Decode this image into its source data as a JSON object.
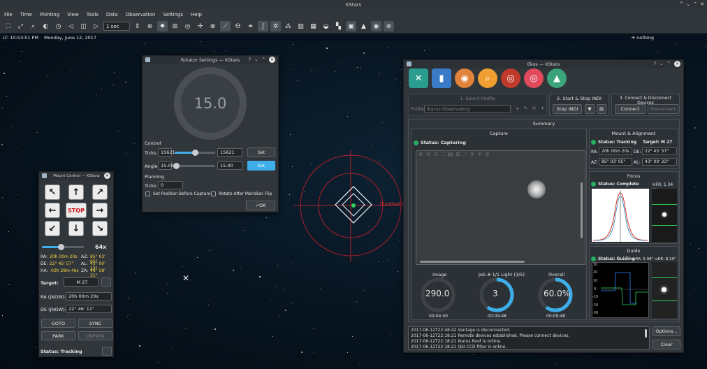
{
  "window": {
    "title": "KStars"
  },
  "menu": [
    "File",
    "Time",
    "Pointing",
    "View",
    "Tools",
    "Data",
    "Observation",
    "Settings",
    "Help"
  ],
  "toolbar": {
    "time_step": "1 sec"
  },
  "status": {
    "lt": "LT: 10:53:51 PM",
    "date": "Monday, June 12, 2017",
    "object": "nothing"
  },
  "sky": {
    "target_label": "Dumbbell Ne"
  },
  "rotator": {
    "title": "Rotator Settings — KStars",
    "dial_value": "15.0",
    "control_label": "Control",
    "ticks_label": "Ticks:",
    "ticks_value": "15621",
    "ticks_spin": "15621",
    "ticks_fraction": 0.5,
    "angle_label": "Angle:",
    "angle_value": "15.00",
    "angle_spin": "15.00",
    "angle_fraction": 0.04,
    "set_label": "Set",
    "planning_label": "Planning",
    "plan_ticks_label": "Ticks:",
    "plan_ticks_value": "0",
    "set_before_capture": "Set Position Before Capture",
    "rotate_after_flip": "Rotate After Meridian Flip",
    "ok_label": "OK"
  },
  "mount": {
    "title": "Mount Control — KStars",
    "stop_label": "STOP",
    "speed": "64x",
    "speed_fraction": 0.45,
    "ra_label": "RA:",
    "ra": "20h 00m 20s",
    "az_label": "AZ:",
    "az": "85° 03' 05\"",
    "de_label": "DE:",
    "de": "22° 45' 57\"",
    "al_label": "AL:",
    "al": "43° 00' 23\"",
    "ha_label": "HA:",
    "ha": "-03h 28m 46s",
    "za_label": "ZA:",
    "za": "46° 58' 31\"",
    "target_label": "Target:",
    "target": "M 27",
    "ra_jnow_label": "RA (JNOW):",
    "ra_jnow": "20h 00m 20s",
    "de_jnow_label": "DE (JNOW):",
    "de_jnow": "22° 46' 11\"",
    "goto": "GOTO",
    "sync": "SYNC",
    "park": "PARK",
    "unpark": "UNPARK",
    "status_label": "Status: Tracking"
  },
  "ekos": {
    "title": "Ekos — KStars",
    "select_profile": "1. Select Profile",
    "profile_label": "Profile:",
    "profile_value": "Ikarus Observatory",
    "start_stop": "2. Start & Stop INDI",
    "stop_indi": "Stop INDI",
    "connect_section": "3. Connect & Disconnect Devices",
    "connect": "Connect",
    "disconnect": "Disconnect",
    "summary": "Summary",
    "capture": {
      "title": "Capture",
      "status": "Status: Capturing",
      "image_label": "Image",
      "image_value": "290.0",
      "image_time": "00:04:50",
      "job_label": "Job # 1/1 Light (3/5)",
      "job_value": "3",
      "job_time": "00:09:48",
      "overall_label": "Overall",
      "overall_value": "60.0%",
      "overall_time": "00:09:48"
    },
    "mount": {
      "title": "Mount & Alignment",
      "status": "Status: Tracking",
      "target": "Target: M 27",
      "ra_label": "RA:",
      "ra": "20h 00m 20s",
      "de_label": "DE:",
      "de": "22° 45' 57\"",
      "az_label": "AZ:",
      "az": "85° 03' 05\"",
      "al_label": "AL:",
      "al": "43° 00' 23\""
    },
    "focus": {
      "title": "Focus",
      "status": "Status: Complete",
      "hfr": "HFR: 1.34 px"
    },
    "guide": {
      "title": "Guide",
      "status": "Status: Guiding",
      "sra": "σRA: 5.98\"",
      "sde": "σDE: 8.19\"",
      "yticks": [
        "30",
        "20",
        "10",
        "0",
        "-10",
        "-20",
        "-30"
      ]
    },
    "log": [
      "2017-06-12T22:48:42 Vantage is disconnected.",
      "2017-06-12T22:18:21 Remote devices established. Please connect devices.",
      "2017-06-12T22:18:21 Ikarus Roof is online.",
      "2017-06-12T22:18:21 QSI CCD filter is online."
    ],
    "options": "Options...",
    "clear": "Clear"
  }
}
